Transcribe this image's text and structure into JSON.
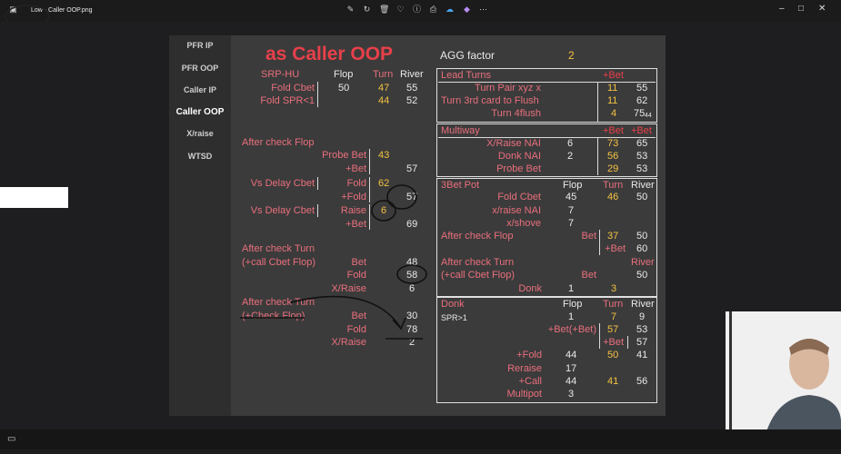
{
  "window": {
    "title": "Low - Caller OOP.png"
  },
  "colors": {
    "pink": "#e96f7d",
    "yellow": "#f5c242",
    "red": "#e8404a",
    "background": "#3b3b3b"
  },
  "toolbar": {
    "icons": [
      "edit-icon",
      "rotate-icon",
      "delete-icon",
      "favorite-icon",
      "info-icon",
      "print-icon",
      "cloud-icon",
      "copilot-icon",
      "more-icon"
    ]
  },
  "nav": {
    "items": [
      "PFR IP",
      "PFR OOP",
      "Caller IP",
      "Caller OOP",
      "X/raise",
      "WTSD"
    ],
    "active": "Caller OOP"
  },
  "slide": {
    "title": "as Caller OOP",
    "agg_label": "AGG factor",
    "agg_value": "2",
    "left": {
      "header": {
        "label": "SRP-HU",
        "flop": "Flop",
        "turn": "Turn",
        "river": "River"
      },
      "fold_cbet": {
        "label": "Fold Cbet",
        "flop": "50",
        "turn": "47",
        "river": "55"
      },
      "fold_spr": {
        "label": "Fold SPR<1",
        "turn": "44",
        "river": "52"
      },
      "after_check_flop": "After check Flop",
      "probe_bet": {
        "label": "Probe Bet",
        "turn": "43"
      },
      "probe_plus_bet": {
        "label": "+Bet",
        "river": "57"
      },
      "vs_delay_1": {
        "label": "Vs Delay Cbet",
        "action": "Fold",
        "turn": "62"
      },
      "vs_delay_1b": {
        "label": "+Fold",
        "river": "57"
      },
      "vs_delay_2": {
        "label": "Vs Delay Cbet",
        "action": "Raise",
        "turn": "6"
      },
      "vs_delay_2b": {
        "label": "+Bet",
        "river": "69"
      },
      "after_check_turn": "After check Turn",
      "call_cbet_flop": "(+call Cbet Flop)",
      "act_bet": {
        "label": "Bet",
        "river": "48"
      },
      "act_fold": {
        "label": "Fold",
        "river": "58"
      },
      "act_xraise": {
        "label": "X/Raise",
        "river": "6"
      },
      "after_check_turn2": "After check Turn",
      "check_flop": "(+Check Flop)",
      "act2_bet": {
        "label": "Bet",
        "river": "30"
      },
      "act2_fold": {
        "label": "Fold",
        "river": "78"
      },
      "act2_xraise": {
        "label": "X/Raise",
        "river": "2"
      }
    },
    "lead": {
      "title": "Lead Turns",
      "head": "+Bet",
      "rows": [
        {
          "label": "Turn Pair xyz x",
          "a": "11",
          "b": "55"
        },
        {
          "label": "Turn 3rd card to Flush",
          "a": "11",
          "b": "62"
        },
        {
          "label": "Turn 4flush",
          "a": "4",
          "b": "75",
          "sub": "44"
        }
      ]
    },
    "multiway": {
      "title": "Multiway",
      "h1": "+Bet",
      "h2": "+Bet",
      "rows": [
        {
          "label": "X/Raise NAI",
          "f": "6",
          "a": "73",
          "b": "65"
        },
        {
          "label": "Donk NAI",
          "f": "2",
          "a": "56",
          "b": "53"
        },
        {
          "label": "Probe Bet",
          "a": "29",
          "b": "53"
        }
      ]
    },
    "bet3": {
      "title": "3Bet Pot",
      "flop": "Flop",
      "turn": "Turn",
      "river": "River",
      "fold_cbet": {
        "label": "Fold Cbet",
        "flop": "45",
        "turn": "46",
        "river": "50"
      },
      "xraise_nai": {
        "label": "x/raise NAI",
        "flop": "7"
      },
      "xshove": {
        "label": "x/shove",
        "flop": "7"
      },
      "after_check_flop": "After check Flop",
      "acf_bet": {
        "label": "Bet",
        "turn": "37",
        "river": "50"
      },
      "acf_plus_bet": {
        "label": "+Bet",
        "river": "60"
      },
      "after_check_turn": "After check Turn",
      "river_head": "River",
      "call_cbet_flop": "(+call Cbet Flop)",
      "act_bet": {
        "label": "Bet",
        "river": "50"
      },
      "donk": {
        "label": "Donk",
        "flop": "1",
        "turn": "3"
      }
    },
    "donk": {
      "title": "Donk",
      "flop": "Flop",
      "turn": "Turn",
      "river": "River",
      "spr": "SPR>1",
      "r1": {
        "flop": "1",
        "turn": "7",
        "river": "9"
      },
      "r2": {
        "label": "+Bet(+Bet)",
        "turn": "57",
        "river": "53"
      },
      "r3": {
        "label": "+Bet",
        "river": "57"
      },
      "r4": {
        "label": "+Fold",
        "flop": "44",
        "turn": "50",
        "river": "41"
      },
      "r5": {
        "label": "Reraise",
        "flop": "17"
      },
      "r6": {
        "label": "+Call",
        "flop": "44",
        "turn": "41",
        "river": "56"
      },
      "r7": {
        "label": "Multipot",
        "flop": "3"
      }
    }
  }
}
